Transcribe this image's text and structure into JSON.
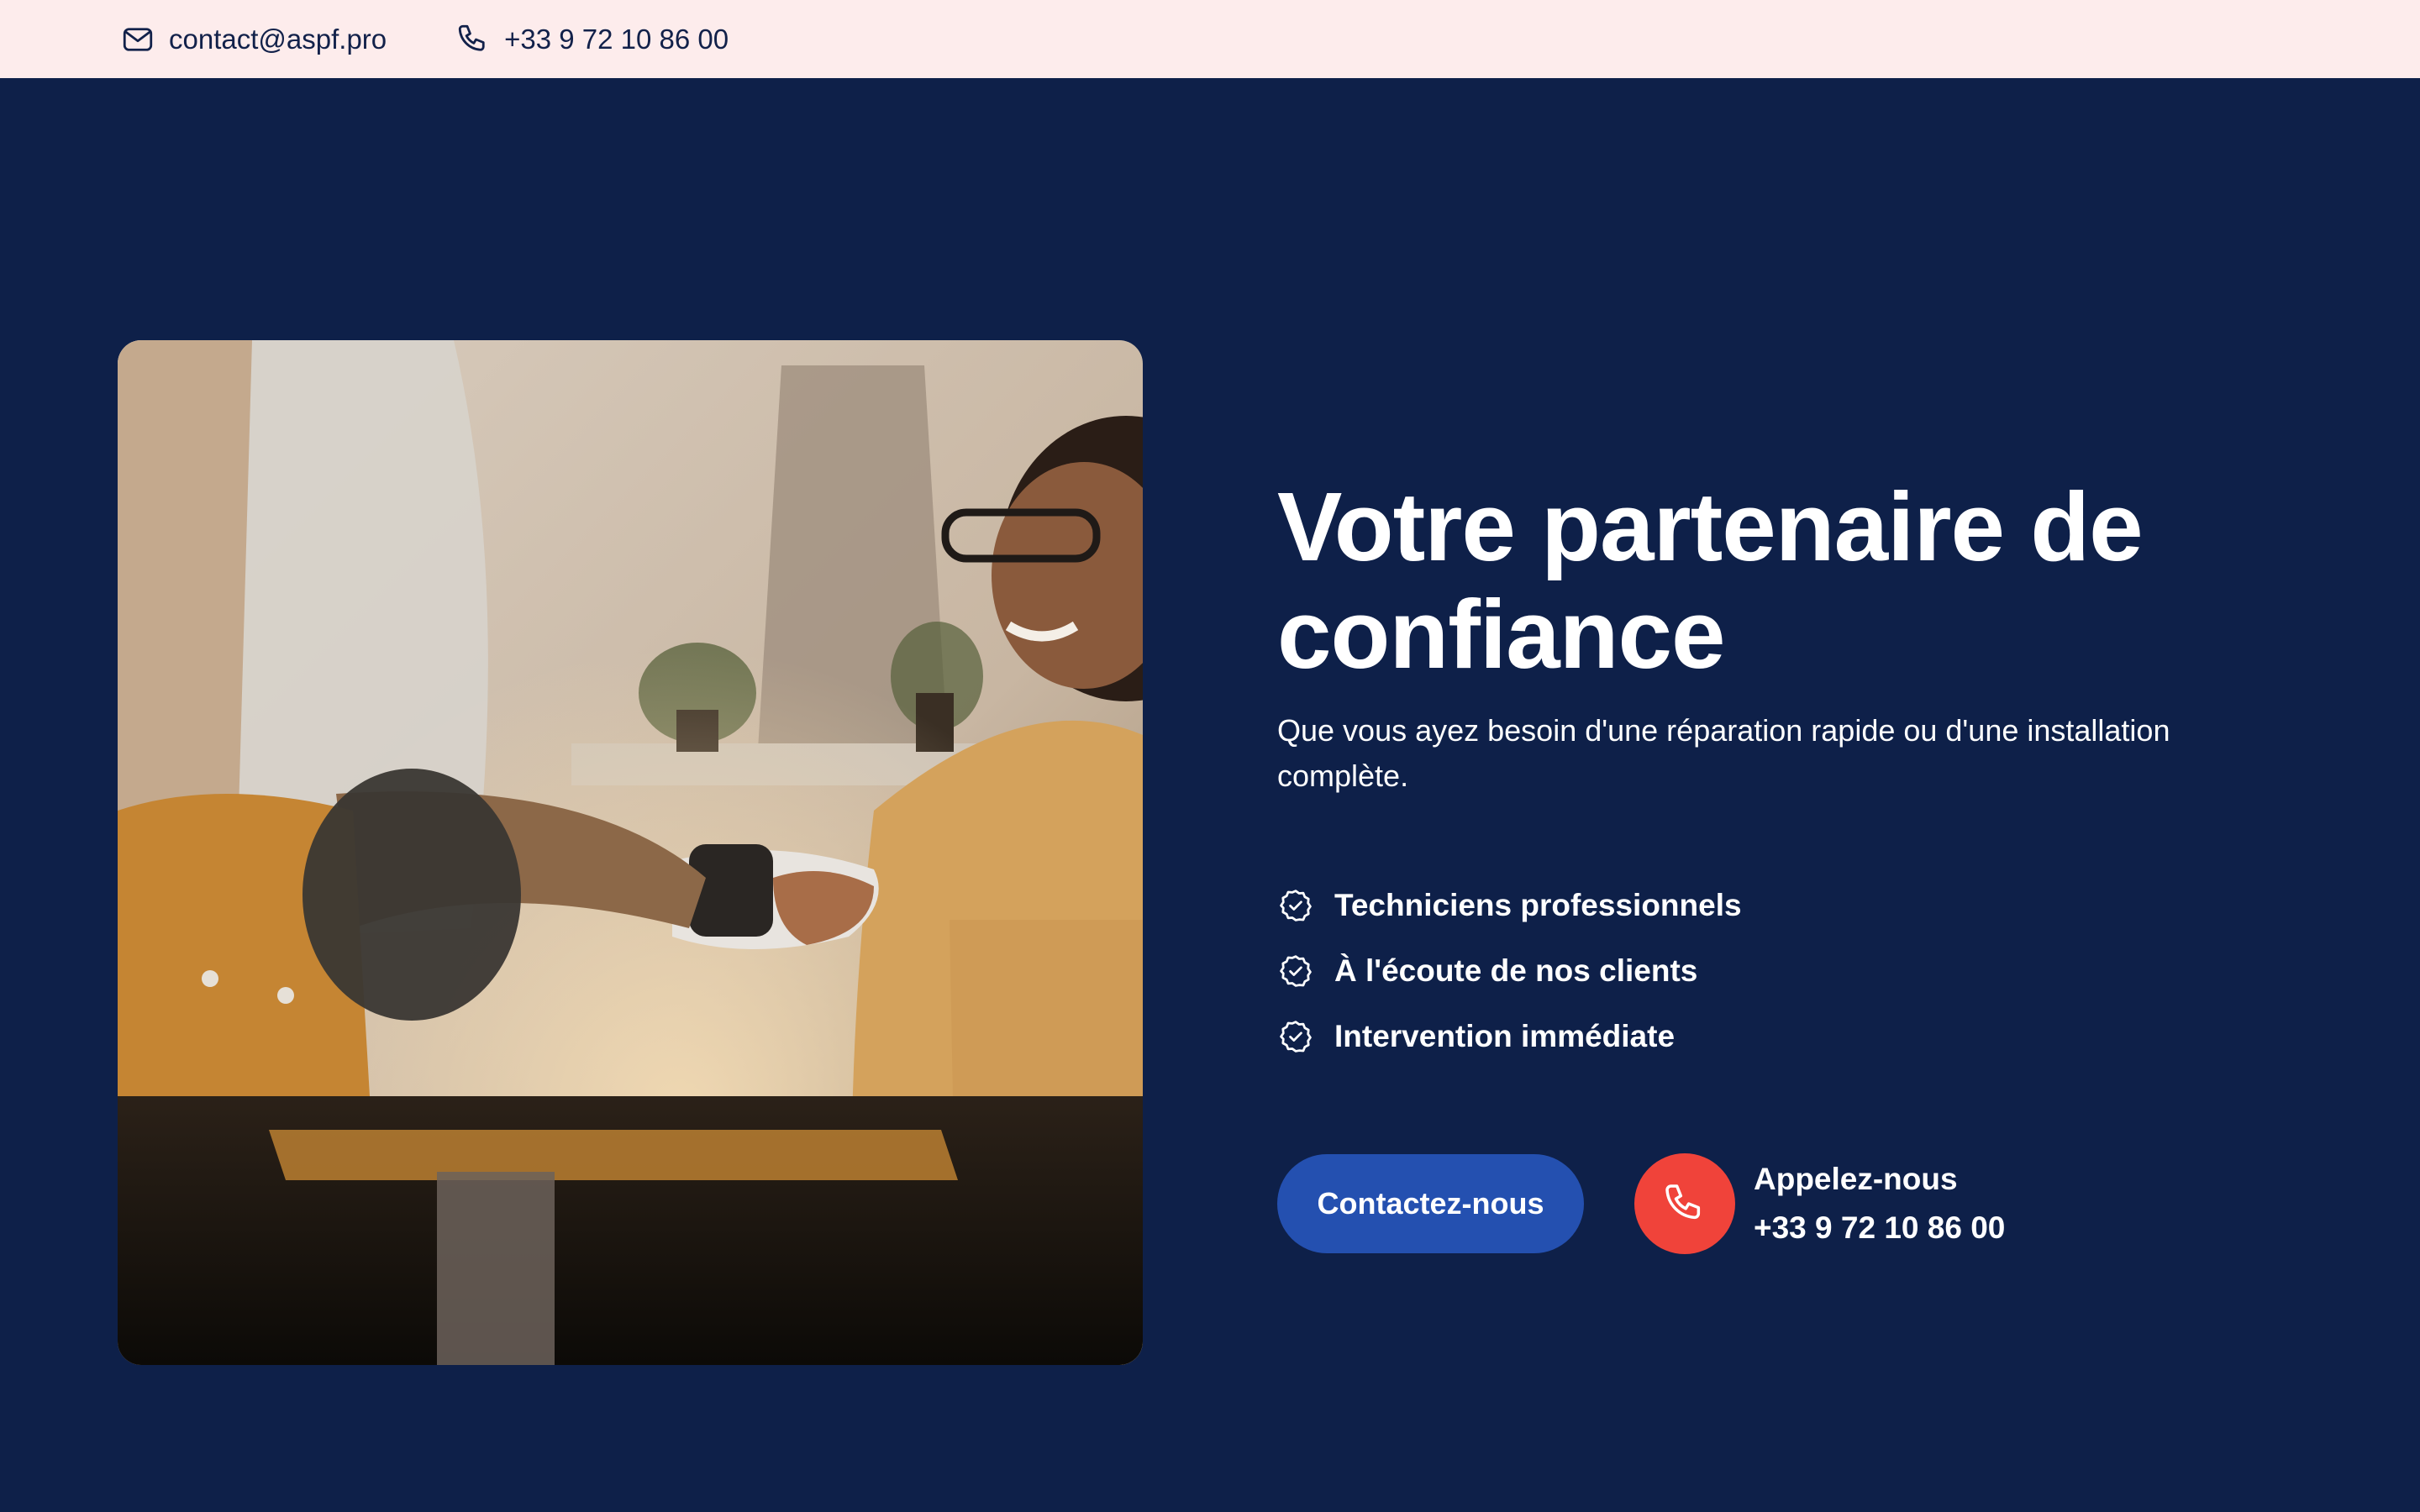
{
  "topbar": {
    "email": "contact@aspf.pro",
    "phone": "+33 9 72 10 86 00",
    "email_icon": "mail-icon",
    "phone_icon": "phone-icon"
  },
  "hero": {
    "image_alt": "Technicien serrant la main d'une cliente souriante",
    "headline": "Votre partenaire de confiance",
    "subtitle": "Que vous ayez besoin d'une réparation rapide ou d'une installation complète.",
    "features": [
      {
        "icon": "badge-check-icon",
        "label": "Techniciens professionnels"
      },
      {
        "icon": "badge-check-icon",
        "label": "À l'écoute de nos clients"
      },
      {
        "icon": "badge-check-icon",
        "label": "Intervention immédiate"
      }
    ],
    "cta_label": "Contactez-nous",
    "call_label": "Appelez-nous",
    "call_phone": "+33 9 72 10 86 00"
  },
  "colors": {
    "navy_background": "#0e2049",
    "topbar_background": "#fdecec",
    "button_blue": "#2450b0",
    "call_red": "#f0433a",
    "text_dark": "#12214a"
  }
}
